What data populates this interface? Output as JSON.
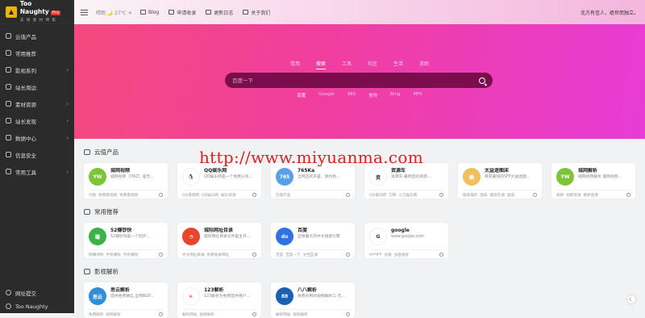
{
  "logo": {
    "name": "Too Naughty",
    "badge": "Pro",
    "subtitle": "美 搜 素 材 网 集"
  },
  "sidebar": {
    "items": [
      {
        "label": "云值产品",
        "icon": "cloud-icon",
        "has_children": false
      },
      {
        "label": "常用推荐",
        "icon": "star-icon",
        "has_children": false
      },
      {
        "label": "影视系列",
        "icon": "film-icon",
        "has_children": true
      },
      {
        "label": "站长周边",
        "icon": "tool-icon",
        "has_children": false
      },
      {
        "label": "素材资源",
        "icon": "folder-icon",
        "has_children": true
      },
      {
        "label": "站长发现",
        "icon": "compass-icon",
        "has_children": true
      },
      {
        "label": "数据中心",
        "icon": "database-icon",
        "has_children": true
      },
      {
        "label": "信息安全",
        "icon": "shield-icon",
        "has_children": false
      },
      {
        "label": "常用工具",
        "icon": "wrench-icon",
        "has_children": true
      }
    ],
    "bottom": [
      {
        "label": "网址提交",
        "icon": "submit-icon"
      },
      {
        "label": "Too Naughty",
        "icon": "info-icon"
      }
    ],
    "chevron": "›"
  },
  "topbar": {
    "weather": "晴朗  🌙  27℃  ☀",
    "links": [
      "Blog",
      "申请收录",
      "更新日志",
      "关于我们"
    ],
    "right_text": "北方有佳人，绝世而独立。"
  },
  "hero": {
    "tabs": [
      "常用",
      "搜索",
      "工具",
      "社区",
      "生活",
      "求职"
    ],
    "active_tab": 1,
    "placeholder": "百度一下",
    "engines": [
      "百度",
      "Google",
      "360",
      "搜狗",
      "Bing",
      "MFS"
    ],
    "active_engine": 0
  },
  "watermark": "http://www.miyuanma.com",
  "sections": [
    {
      "title": "云值产品",
      "cards": [
        {
          "title": "城网视频",
          "desc": "城网视频（YWZ）是无...",
          "logo_text": "YW",
          "logo_color": "#7cc43a",
          "tags": [
            "付款",
            "免费看视频",
            "免费看视频"
          ]
        },
        {
          "title": "QQ娱乐网",
          "desc": "QQ娱乐网是一个免费分享...",
          "logo_text": "🐧",
          "logo_color": "#ffffff",
          "tags": [
            "QQ值值网",
            "QQ娱乐网",
            "娱乐资源"
          ]
        },
        {
          "title": "765Ka",
          "desc": "全网店式声誉，简约易...",
          "logo_text": "765",
          "logo_color": "#5aa0e8",
          "tags": [
            "云值产品"
          ]
        },
        {
          "title": "资源车",
          "desc": "资源车 最稳定的资源...",
          "logo_text": "资",
          "logo_color": "#ffffff",
          "tags": [
            "QQ值乐网",
            "刀网",
            "火刀娱乐网"
          ]
        },
        {
          "title": "太益迷图床",
          "desc": "目前最快的SFP大益迷图...",
          "logo_text": "图",
          "logo_color": "#f0c060",
          "tags": [
            "图床操作",
            "图床",
            "图床在线",
            "图床"
          ]
        },
        {
          "title": "城网解析",
          "desc": "城网视频解析 城网视频...",
          "logo_text": "YW",
          "logo_color": "#7cc43a",
          "tags": [
            "视频",
            "视频资源",
            "解析资源"
          ]
        }
      ]
    },
    {
      "title": "常用推荐",
      "cards": [
        {
          "title": "52赚钞快",
          "desc": "52赚钞快是一个同步...",
          "logo_text": "赚",
          "logo_color": "#3cb34a",
          "tags": [
            "网赚项目",
            "手机赚钱",
            "手机赚钱"
          ]
        },
        {
          "title": "城际网址目录",
          "desc": "城际网址目录文件是主开...",
          "logo_text": "◔",
          "logo_color": "#e8452c",
          "tags": [
            "中文网址目录",
            "免费收录网址"
          ]
        },
        {
          "title": "百度",
          "desc": "全球最大的中文搜索引擎",
          "logo_text": "du",
          "logo_color": "#2d73e6",
          "tags": [
            "百度",
            "百度一下",
            "文档互通"
          ]
        },
        {
          "title": "google",
          "desc": "www.google.com",
          "logo_text": "G",
          "logo_color": "#ffffff",
          "tags": [
            "google",
            "谷歌",
            "谷歌搜索"
          ]
        }
      ]
    },
    {
      "title": "影视解析",
      "cards": [
        {
          "title": "思云解析",
          "desc": "提供免费微信,全网BGP...",
          "logo_text": "思云",
          "logo_color": "#2f8fd8",
          "tags": [
            "免费解析",
            "视频解析"
          ]
        },
        {
          "title": "123解析",
          "desc": "123解析为免费提供用户...",
          "logo_text": "🍬",
          "logo_color": "#ffffff",
          "tags": [
            "解析网站",
            "视频解析"
          ]
        },
        {
          "title": "八八解析",
          "desc": "免费好用的视频解析口 无...",
          "logo_text": "88",
          "logo_color": "#1a5fb4",
          "tags": [
            "解析网站",
            "视频解析"
          ]
        }
      ]
    }
  ]
}
